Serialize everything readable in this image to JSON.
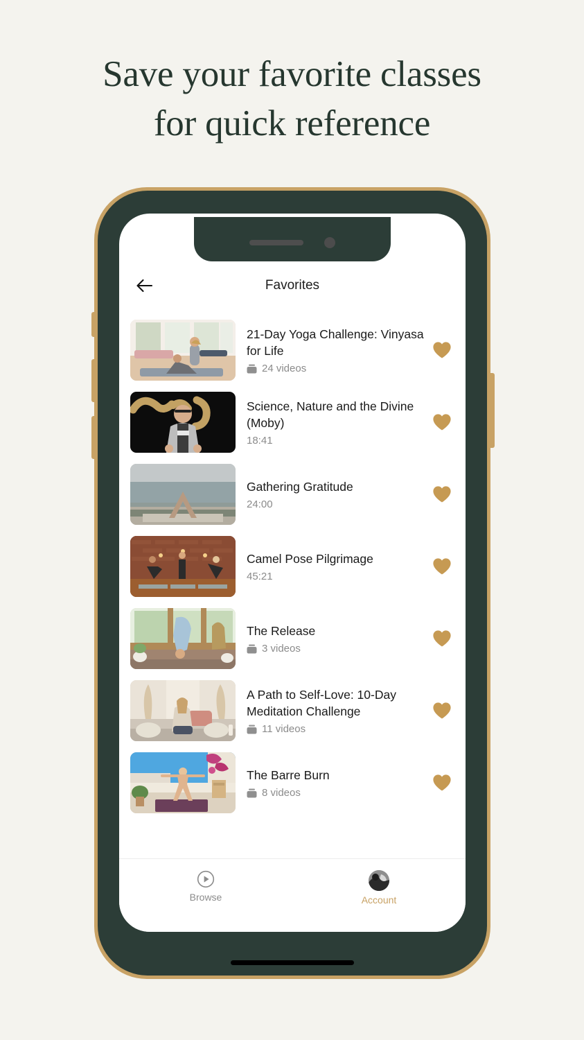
{
  "headline": {
    "line1": "Save your favorite classes",
    "line2": "for quick reference"
  },
  "colors": {
    "page_background": "#f4f3ee",
    "headline_text": "#26372f",
    "phone_frame_gold": "#c8a265",
    "phone_bezel_dark": "#2c3d37",
    "accent_gold": "#c8a265",
    "heart_gold": "#c69a53",
    "meta_gray": "#8b8b8b",
    "title_text": "#1a1a1a"
  },
  "app": {
    "header": {
      "back_icon": "arrow-left-icon",
      "title": "Favorites"
    },
    "favorites": [
      {
        "title": "21-Day Yoga Challenge: Vinyasa for Life",
        "meta": "24 videos",
        "meta_type": "videos",
        "meta_icon": "stack-icon",
        "favorited": true,
        "thumbnail_alt": "Two people practicing yoga in a bright studio with large windows"
      },
      {
        "title": "Science, Nature and the Divine (Moby)",
        "meta": "18:41",
        "meta_type": "duration",
        "meta_icon": "",
        "favorited": true,
        "thumbnail_alt": "Man in gray hoodie and glasses speaking on a dark stage with gold script lettering"
      },
      {
        "title": "Gathering Gratitude",
        "meta": "24:00",
        "meta_type": "duration",
        "meta_icon": "",
        "favorited": true,
        "thumbnail_alt": "Person in downward dog pose on a beach at dusk by the ocean"
      },
      {
        "title": "Camel Pose Pilgrimage",
        "meta": "45:21",
        "meta_type": "duration",
        "meta_icon": "",
        "favorited": true,
        "thumbnail_alt": "Three people practicing yoga in a brick-walled studio with wooden floor"
      },
      {
        "title": "The Release",
        "meta": "3 videos",
        "meta_type": "videos",
        "meta_icon": "stack-icon",
        "favorited": true,
        "thumbnail_alt": "Person in forward fold by a sunlit window with plants and an elephant statue"
      },
      {
        "title": "A Path to Self-Love: 10-Day Meditation Challenge",
        "meta": "11 videos",
        "meta_type": "videos",
        "meta_icon": "stack-icon",
        "favorited": true,
        "thumbnail_alt": "Woman meditating cross-legged on cushions with pampas grass decor"
      },
      {
        "title": "The Barre Burn",
        "meta": "8 videos",
        "meta_type": "videos",
        "meta_icon": "stack-icon",
        "favorited": true,
        "thumbnail_alt": "Woman in wide-legged stance on a purple mat on a sunny rooftop terrace"
      }
    ],
    "tabbar": [
      {
        "label": "Browse",
        "icon": "play-circle-icon",
        "active": false
      },
      {
        "label": "Account",
        "icon": "avatar",
        "active": true
      }
    ]
  }
}
